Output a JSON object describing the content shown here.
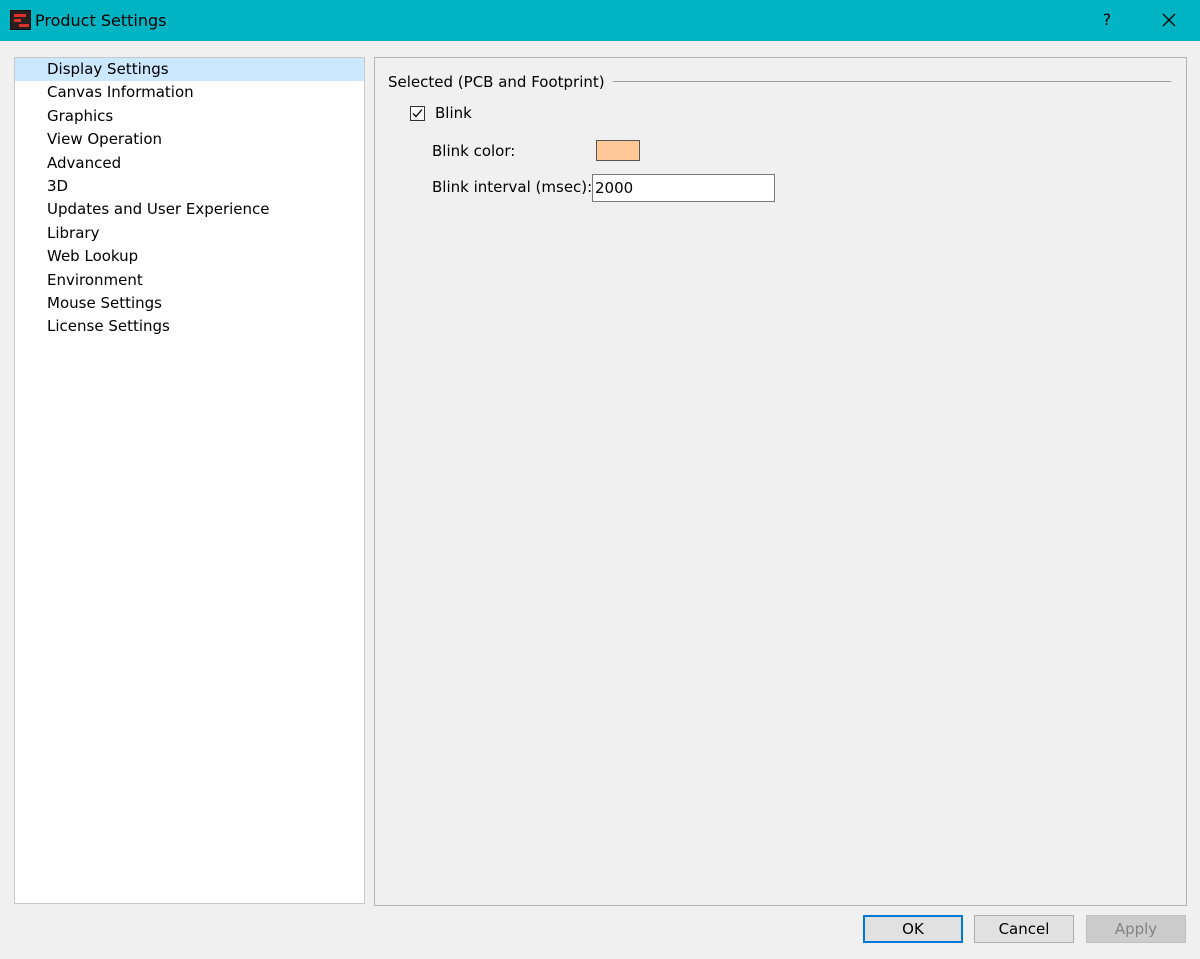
{
  "window": {
    "title": "Product Settings",
    "help_label": "?",
    "accent_color": "#00b4c4"
  },
  "nav": {
    "items": [
      {
        "label": "Display Settings",
        "selected": true
      },
      {
        "label": "Canvas Information"
      },
      {
        "label": "Graphics"
      },
      {
        "label": "View Operation"
      },
      {
        "label": "Advanced"
      },
      {
        "label": "3D"
      },
      {
        "label": "Updates and User Experience"
      },
      {
        "label": "Library"
      },
      {
        "label": "Web Lookup"
      },
      {
        "label": "Environment"
      },
      {
        "label": "Mouse Settings"
      },
      {
        "label": "License Settings"
      }
    ],
    "selected_color": "#cce8ff"
  },
  "content": {
    "group_title": "Selected (PCB and Footprint)",
    "blink": {
      "label": "Blink",
      "checked": true
    },
    "blink_color": {
      "label": "Blink color:",
      "value": "#ffc896"
    },
    "blink_interval": {
      "label": "Blink interval (msec):",
      "value": "2000"
    }
  },
  "buttons": {
    "ok": "OK",
    "cancel": "Cancel",
    "apply": "Apply"
  },
  "icons": {
    "app": "app-logo-icon",
    "close": "close-icon",
    "check": "checkmark-icon"
  }
}
